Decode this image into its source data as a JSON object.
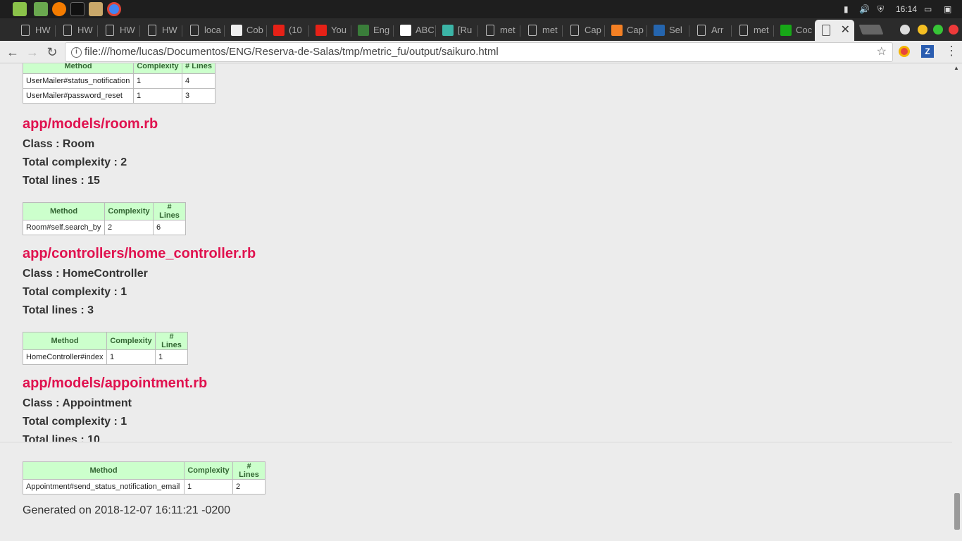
{
  "panel": {
    "time": "16:14"
  },
  "tabs": [
    {
      "title": "HW",
      "icon": "doc"
    },
    {
      "title": "HW",
      "icon": "doc"
    },
    {
      "title": "HW",
      "icon": "doc"
    },
    {
      "title": "HW",
      "icon": "doc"
    },
    {
      "title": "loca",
      "icon": "doc"
    },
    {
      "title": "Cob",
      "icon": "github"
    },
    {
      "title": "(10",
      "icon": "youtube"
    },
    {
      "title": "You",
      "icon": "youtube"
    },
    {
      "title": "Eng",
      "icon": "flag"
    },
    {
      "title": "ABC",
      "icon": "wikipedia"
    },
    {
      "title": "[Ru",
      "icon": "sd"
    },
    {
      "title": "met",
      "icon": "doc"
    },
    {
      "title": "met",
      "icon": "doc"
    },
    {
      "title": "Cap",
      "icon": "doc"
    },
    {
      "title": "Cap",
      "icon": "stackoverflow"
    },
    {
      "title": "Sel",
      "icon": "w3"
    },
    {
      "title": "Arr",
      "icon": "doc"
    },
    {
      "title": "met",
      "icon": "doc"
    },
    {
      "title": "Coc",
      "icon": "green"
    },
    {
      "title": "",
      "icon": "doc",
      "active": true
    }
  ],
  "toolbar": {
    "url": "file:///home/lucas/Documentos/ENG/Reserva-de-Salas/tmp/metric_fu/output/saikuro.html"
  },
  "headers": {
    "method": "Method",
    "complexity": "Complexity",
    "lines": "# Lines"
  },
  "partial_table": {
    "rows": [
      {
        "method": "UserMailer#status_notification",
        "complexity": "1",
        "lines": "4"
      },
      {
        "method": "UserMailer#password_reset",
        "complexity": "1",
        "lines": "3"
      }
    ]
  },
  "sections": [
    {
      "file": "app/models/room.rb",
      "class": "Class : Room",
      "total_complexity": "Total complexity : 2",
      "total_lines": "Total lines : 15",
      "rows": [
        {
          "method": "Room#self.search_by",
          "complexity": "2",
          "lines": "6"
        }
      ]
    },
    {
      "file": "app/controllers/home_controller.rb",
      "class": "Class : HomeController",
      "total_complexity": "Total complexity : 1",
      "total_lines": "Total lines : 3",
      "rows": [
        {
          "method": "HomeController#index",
          "complexity": "1",
          "lines": "1"
        }
      ]
    },
    {
      "file": "app/models/appointment.rb",
      "class": "Class : Appointment",
      "total_complexity": "Total complexity : 1",
      "total_lines": "Total lines : 10",
      "rows": [
        {
          "method": "Appointment#send_status_notification_email",
          "complexity": "1",
          "lines": "2"
        }
      ]
    }
  ],
  "footer": {
    "generated": "Generated on 2018-12-07 16:11:21 -0200"
  },
  "colors": {
    "heading": "#e0124f",
    "table_header_bg": "#ccffcc",
    "table_header_text": "#336633"
  }
}
